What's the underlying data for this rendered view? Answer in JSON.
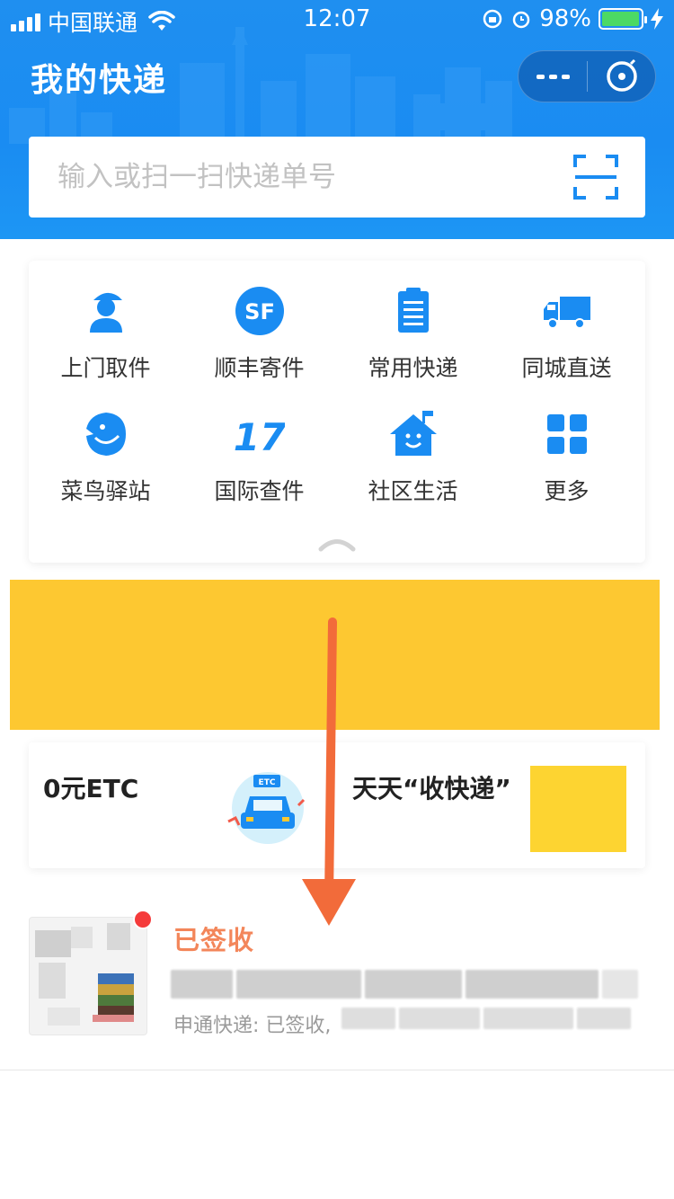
{
  "status_bar": {
    "carrier": "中国联通",
    "time": "12:07",
    "battery": "98%"
  },
  "header": {
    "title": "我的快递"
  },
  "search": {
    "placeholder": "输入或扫一扫快递单号"
  },
  "services": [
    {
      "label": "上门取件",
      "icon": "courier-pickup-icon"
    },
    {
      "label": "顺丰寄件",
      "icon": "sf-express-icon",
      "icon_text": "SF"
    },
    {
      "label": "常用快递",
      "icon": "clipboard-list-icon"
    },
    {
      "label": "同城直送",
      "icon": "truck-icon"
    },
    {
      "label": "菜鸟驿站",
      "icon": "cainiao-bird-icon"
    },
    {
      "label": "国际查件",
      "icon": "international-17-icon",
      "icon_text": "17"
    },
    {
      "label": "社区生活",
      "icon": "community-house-icon"
    },
    {
      "label": "更多",
      "icon": "grid-more-icon"
    }
  ],
  "promo": {
    "left_title": "0元ETC",
    "etc_badge": "ETC",
    "right_title": "天天“收快递”"
  },
  "parcel": {
    "status": "已签收",
    "description": "申通快递: 已签收,"
  },
  "colors": {
    "header_blue": "#1a8cf2",
    "icon_blue": "#1a8cf2",
    "banner_yellow": "#fdc831",
    "status_orange": "#f3865a",
    "arrow_orange": "#f26b3a",
    "badge_red": "#f53b3b"
  }
}
